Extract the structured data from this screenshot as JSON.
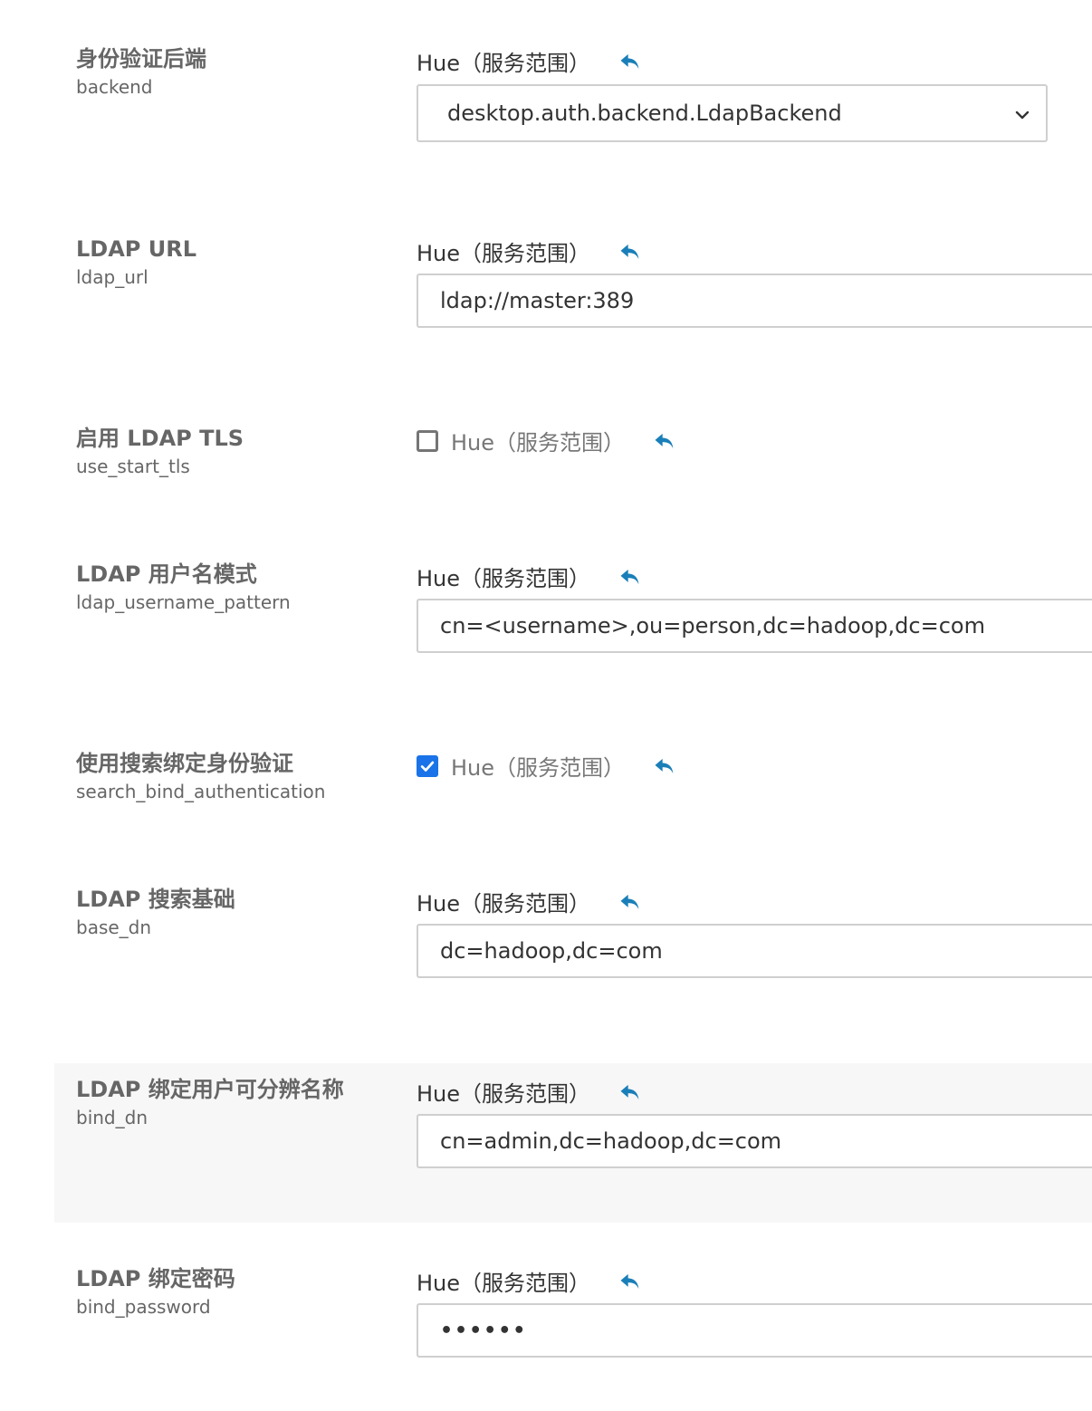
{
  "scope_label": "Hue（服务范围）",
  "settings": [
    {
      "display_name": "身份验证后端",
      "key": "backend",
      "scope": "Hue（服务范围）",
      "control": "select",
      "value": "desktop.auth.backend.LdapBackend"
    },
    {
      "display_name": "LDAP URL",
      "key": "ldap_url",
      "scope": "Hue（服务范围）",
      "control": "text",
      "value": "ldap://master:389"
    },
    {
      "display_name": "启用 LDAP TLS",
      "key": "use_start_tls",
      "scope": "Hue（服务范围）",
      "control": "checkbox",
      "checked": false
    },
    {
      "display_name": "LDAP 用户名模式",
      "key": "ldap_username_pattern",
      "scope": "Hue（服务范围）",
      "control": "text",
      "value": "cn=<username>,ou=person,dc=hadoop,dc=com"
    },
    {
      "display_name": "使用搜索绑定身份验证",
      "key": "search_bind_authentication",
      "scope": "Hue（服务范围）",
      "control": "checkbox",
      "checked": true
    },
    {
      "display_name": "LDAP 搜索基础",
      "key": "base_dn",
      "scope": "Hue（服务范围）",
      "control": "text",
      "value": "dc=hadoop,dc=com"
    },
    {
      "display_name": "LDAP 绑定用户可分辨名称",
      "key": "bind_dn",
      "scope": "Hue（服务范围）",
      "control": "text",
      "value": "cn=admin,dc=hadoop,dc=com",
      "highlighted": true
    },
    {
      "display_name": "LDAP 绑定密码",
      "key": "bind_password",
      "scope": "Hue（服务范围）",
      "control": "password",
      "value": "••••••"
    }
  ],
  "colors": {
    "accent": "#1a73e8",
    "revert_icon": "#1a7fb8",
    "label": "#666666",
    "highlight_bg": "#f7f7f7",
    "input_border": "#cfcfcf"
  },
  "icons": {
    "revert": "undo-arrow-icon",
    "select": "chevron-down-icon",
    "check": "checkmark-icon"
  }
}
